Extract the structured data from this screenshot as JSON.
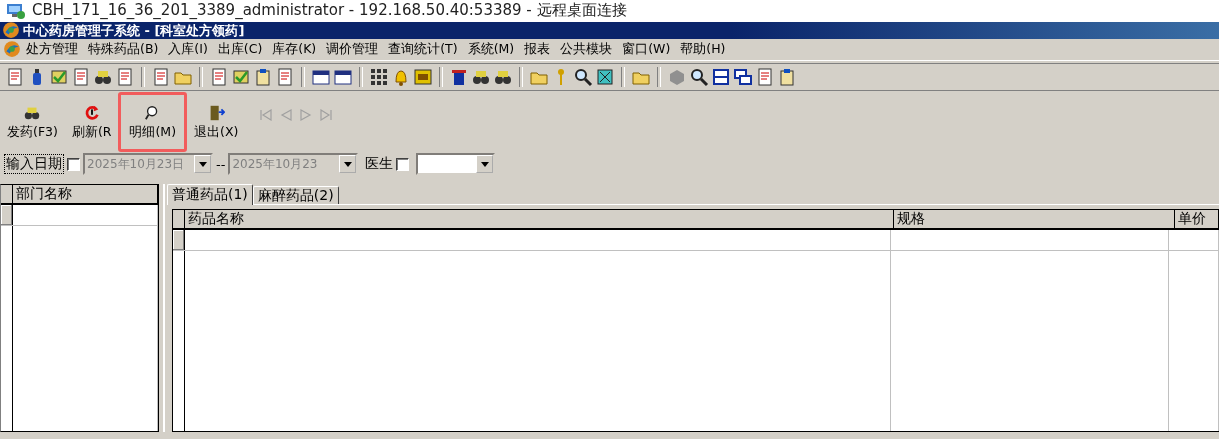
{
  "remote_window": {
    "title": "CBH_171_16_36_201_3389_administrator - 192.168.50.40:53389 - 远程桌面连接"
  },
  "window": {
    "title": "中心药房管理子系统 - [科室处方领药]"
  },
  "menu": [
    "处方管理",
    "特殊药品(B)",
    "入库(I)",
    "出库(C)",
    "库存(K)",
    "调价管理",
    "查询统计(T)",
    "系统(M)",
    "报表",
    "公共模块",
    "窗口(W)",
    "帮助(H)"
  ],
  "actions": [
    {
      "label": "发药(F3)",
      "kind": "dispense",
      "highlighted": false
    },
    {
      "label": "刷新(R",
      "kind": "refresh",
      "highlighted": false
    },
    {
      "label": "明细(M)",
      "kind": "detail",
      "highlighted": true
    },
    {
      "label": "退出(X)",
      "kind": "exit",
      "highlighted": false
    }
  ],
  "nav_buttons": [
    {
      "kind": "first",
      "disabled": true
    },
    {
      "kind": "prev",
      "disabled": true
    },
    {
      "kind": "next",
      "disabled": true
    },
    {
      "kind": "last",
      "disabled": true
    }
  ],
  "filter": {
    "date_label": "输入日期",
    "date_checked": false,
    "date_from": "2025年10月23日",
    "date_from_disabled": true,
    "separator": "--",
    "date_to": "2025年10月23",
    "date_to_disabled": true,
    "doctor_label": "医生",
    "doctor_checked": false
  },
  "department_grid": {
    "columns": [
      "部门名称"
    ]
  },
  "tabs": [
    {
      "label": "普通药品(1)",
      "selected": true
    },
    {
      "label": "麻醉药品(2)",
      "selected": false
    }
  ],
  "drug_grid": {
    "columns": [
      "药品名称",
      "规格",
      "单价"
    ]
  }
}
